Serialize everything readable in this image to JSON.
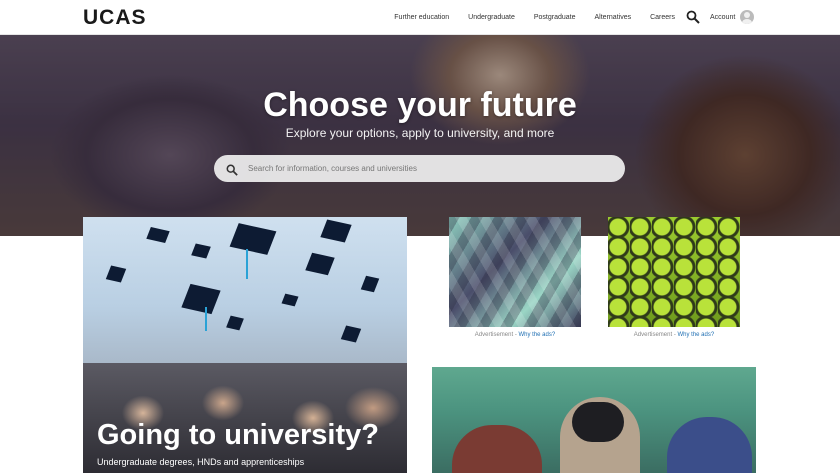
{
  "header": {
    "logo": "UCAS",
    "nav": [
      "Further education",
      "Undergraduate",
      "Postgraduate",
      "Alternatives",
      "Careers"
    ],
    "account_label": "Account"
  },
  "hero": {
    "title": "Choose your future",
    "subtitle": "Explore your options, apply to university, and more",
    "search_placeholder": "Search for information, courses and universities"
  },
  "feature": {
    "title": "Going to university?",
    "subtitle": "Undergraduate degrees, HNDs and apprenticeships"
  },
  "ads": [
    {
      "label": "Advertisement",
      "sep": " - ",
      "link": "Why the ads?"
    },
    {
      "label": "Advertisement",
      "sep": " - ",
      "link": "Why the ads?"
    }
  ]
}
